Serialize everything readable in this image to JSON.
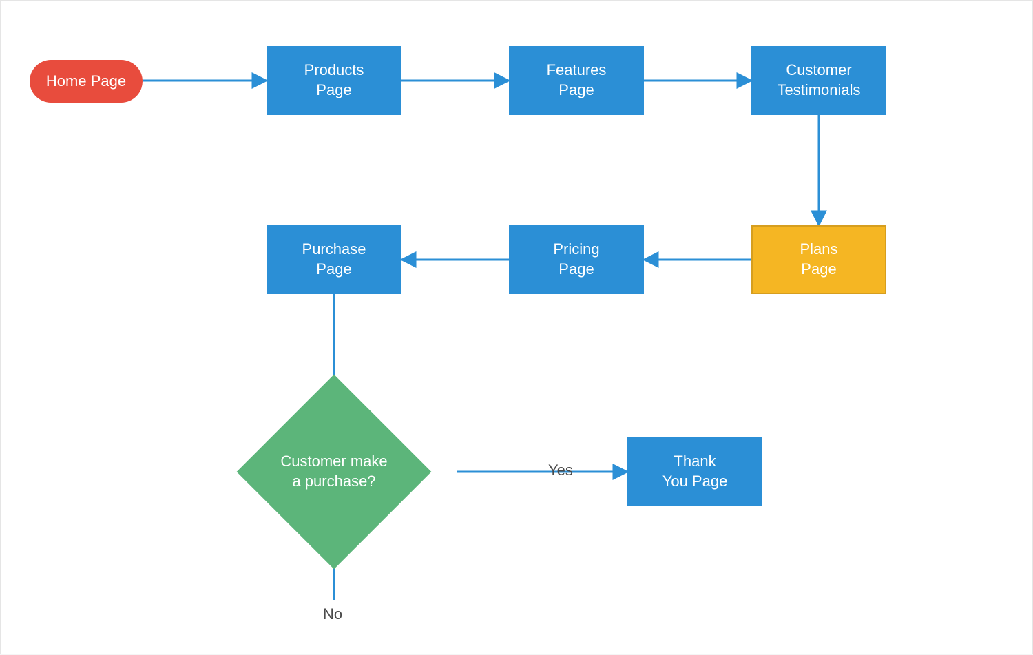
{
  "colors": {
    "start": "#e84c3d",
    "process": "#2b8fd6",
    "highlight_fill": "#f5b623",
    "highlight_border": "#d69e1f",
    "decision": "#5cb57a",
    "edge": "#2b8fd6",
    "text_dark": "#4a4a4a"
  },
  "nodes": {
    "home": {
      "type": "start",
      "label": "Home Page"
    },
    "products": {
      "type": "process",
      "label": "Products\nPage"
    },
    "features": {
      "type": "process",
      "label": "Features\nPage"
    },
    "testimonials": {
      "type": "process",
      "label": "Customer\nTestimonials"
    },
    "plans": {
      "type": "highlight",
      "label": "Plans\nPage"
    },
    "pricing": {
      "type": "process",
      "label": "Pricing\nPage"
    },
    "purchase": {
      "type": "process",
      "label": "Purchase\nPage"
    },
    "decision": {
      "type": "decision",
      "label": "Customer make\na purchase?"
    },
    "thankyou": {
      "type": "process",
      "label": "Thank\nYou  Page"
    }
  },
  "edges": [
    {
      "from": "home",
      "to": "products"
    },
    {
      "from": "products",
      "to": "features"
    },
    {
      "from": "features",
      "to": "testimonials"
    },
    {
      "from": "testimonials",
      "to": "plans"
    },
    {
      "from": "plans",
      "to": "pricing"
    },
    {
      "from": "pricing",
      "to": "purchase"
    },
    {
      "from": "purchase",
      "to": "decision"
    },
    {
      "from": "decision",
      "to": "thankyou",
      "label": "Yes"
    },
    {
      "from": "decision",
      "to": null,
      "label": "No"
    }
  ],
  "edge_labels": {
    "yes": "Yes",
    "no": "No"
  }
}
